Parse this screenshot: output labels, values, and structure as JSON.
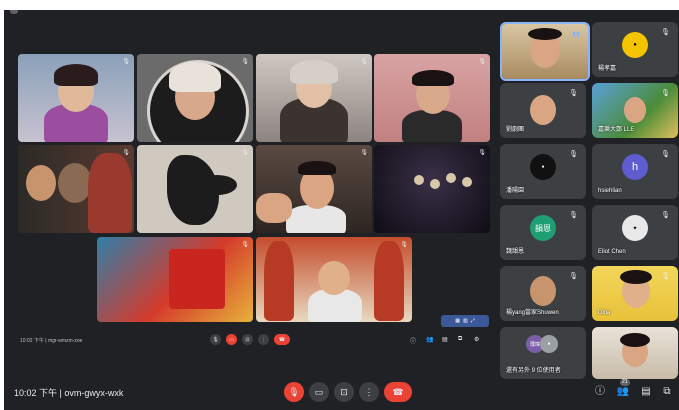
{
  "meeting": {
    "time": "10:02 下午",
    "code": "ovm-gwyx-wxk",
    "separator": "|"
  },
  "inner_meeting": {
    "time": "10:02 下午",
    "code": "mgr-wmzm-zoe"
  },
  "participants_count": "21",
  "grid_tiles": [
    {
      "name": ""
    },
    {
      "name": ""
    },
    {
      "name": ""
    },
    {
      "name": ""
    },
    {
      "name": ""
    },
    {
      "name": ""
    },
    {
      "name": ""
    },
    {
      "name": ""
    },
    {
      "name": ""
    },
    {
      "name": ""
    }
  ],
  "sidebar": [
    {
      "name": "",
      "avatar_letter": "",
      "avatar_color": "#f0f0f0"
    },
    {
      "name": "楊孝嘉",
      "avatar_letter": "",
      "avatar_color": "#f5c400"
    },
    {
      "name": "劉劇團",
      "avatar_letter": "",
      "avatar_color": ""
    },
    {
      "name": "嘉樂大鄭 LLE",
      "avatar_letter": "",
      "avatar_color": ""
    },
    {
      "name": "潘陽園",
      "avatar_letter": "",
      "avatar_color": "#111111"
    },
    {
      "name": "hsiehlian",
      "avatar_letter": "h",
      "avatar_color": "#5e5ccf"
    },
    {
      "name": "魏韻恩",
      "avatar_letter": "韻恩",
      "avatar_color": "#1f9d73"
    },
    {
      "name": "Eliot Chen",
      "avatar_letter": "",
      "avatar_color": "#e8e8e8"
    },
    {
      "name": "楊yang當家Shuwen",
      "avatar_letter": "",
      "avatar_color": ""
    },
    {
      "name": "Dina",
      "avatar_letter": "",
      "avatar_color": ""
    },
    {
      "name": "還有另外 9 位使用者",
      "avatar_letter": "璞瑋",
      "avatar_color": "#7b5ea7"
    },
    {
      "name": "",
      "avatar_letter": "",
      "avatar_color": ""
    }
  ],
  "colors": {
    "background": "#202124",
    "tile": "#3c4043",
    "red": "#ea4335",
    "active_border": "#8ab4f8"
  },
  "icons": [
    "mic-off-icon",
    "camera-icon",
    "present-icon",
    "more-icon",
    "end-call-icon",
    "info-icon",
    "people-icon",
    "chat-icon",
    "activities-icon",
    "host-controls-icon"
  ]
}
